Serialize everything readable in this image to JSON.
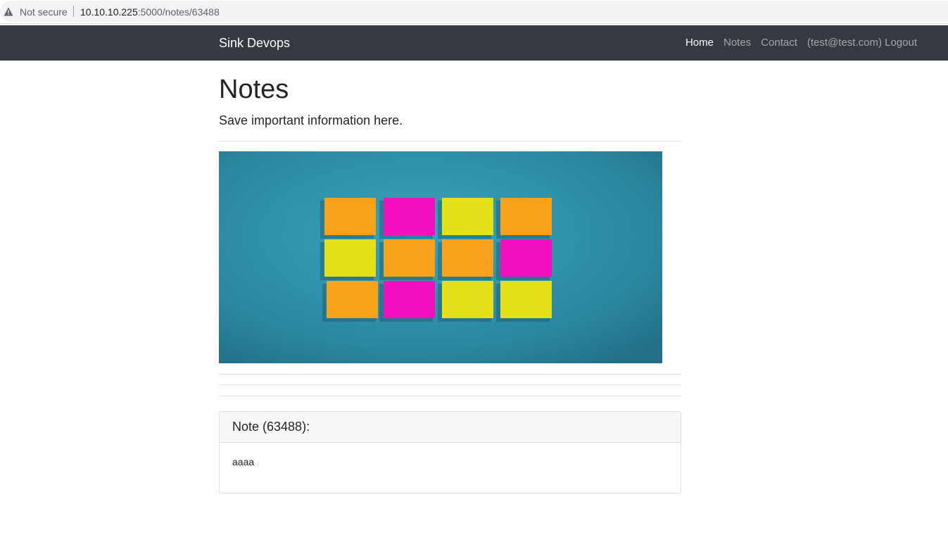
{
  "browser": {
    "security_label": "Not secure",
    "url_host": "10.10.10.225",
    "url_path": ":5000/notes/63488"
  },
  "navbar": {
    "brand": "Sink Devops",
    "links": [
      {
        "label": "Home",
        "active": true
      },
      {
        "label": "Notes",
        "active": false
      },
      {
        "label": "Contact",
        "active": false
      },
      {
        "label": "(test@test.com) Logout",
        "active": false
      }
    ]
  },
  "page": {
    "title": "Notes",
    "subtitle": "Save important information here."
  },
  "hero_image": {
    "subject": "sticky notes on blue wall",
    "background_color": "#2f8ea6",
    "note_colors": {
      "orange": "#f8a21c",
      "pink": "#f20fbd",
      "yellow": "#e5e01a"
    }
  },
  "note": {
    "header": "Note (63488):",
    "body": "aaaa"
  },
  "colors": {
    "navbar_bg": "#343a40",
    "text": "#212529"
  }
}
